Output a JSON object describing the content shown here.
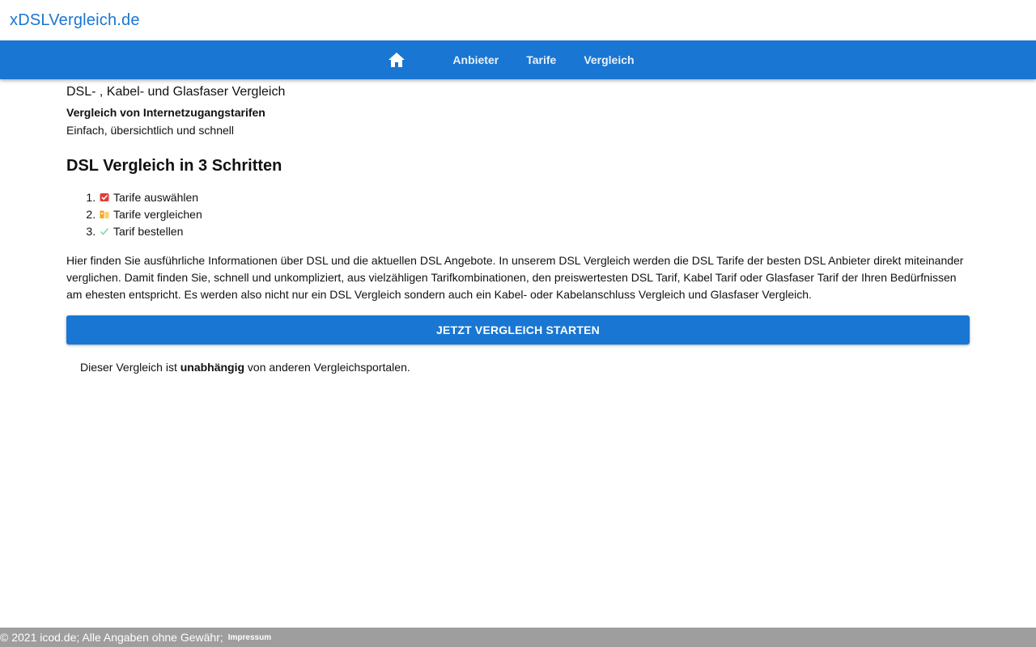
{
  "site": {
    "title": "xDSLVergleich.de"
  },
  "nav": {
    "home_icon": "home-icon",
    "items": [
      {
        "label": "Anbieter"
      },
      {
        "label": "Tarife"
      },
      {
        "label": "Vergleich"
      }
    ]
  },
  "main": {
    "subtitle": "DSL- , Kabel- und Glasfaser Vergleich",
    "bold_heading": "Vergleich von Internetzugangstarifen",
    "tagline": "Einfach, übersichtlich und schnell",
    "steps_heading": "DSL Vergleich in 3 Schritten",
    "steps": [
      {
        "label": "Tarife auswählen",
        "icon": "checkbox-icon",
        "color": "#e53935"
      },
      {
        "label": "Tarife vergleichen",
        "icon": "compare-icon",
        "color": "#f5a623"
      },
      {
        "label": "Tarif bestellen",
        "icon": "checkmark-icon",
        "color": "#7ed6a0"
      }
    ],
    "intro": "Hier finden Sie ausführliche Informationen über DSL und die aktuellen DSL Angebote. In unserem DSL Vergleich werden die DSL Tarife der besten DSL Anbieter direkt miteinander verglichen. Damit finden Sie, schnell und unkompliziert, aus vielzähligen Tarifkombinationen, den preiswertesten DSL Tarif, Kabel Tarif oder Glasfaser Tarif der Ihren Bedürfnissen am ehesten entspricht. Es werden also nicht nur ein DSL Vergleich sondern auch ein Kabel- oder Kabelanschluss Vergleich und Glasfaser Vergleich.",
    "cta_label": "JETZT VERGLEICH STARTEN",
    "note_before": "Dieser Vergleich ist ",
    "note_bold": "unabhängig",
    "note_after": " von anderen Vergleichsportalen."
  },
  "footer": {
    "text": "© 2021 icod.de; Alle Angaben ohne Gewähr;",
    "link": "Impressum"
  },
  "colors": {
    "primary": "#1976d2",
    "footer_bg": "#9e9e9e"
  }
}
